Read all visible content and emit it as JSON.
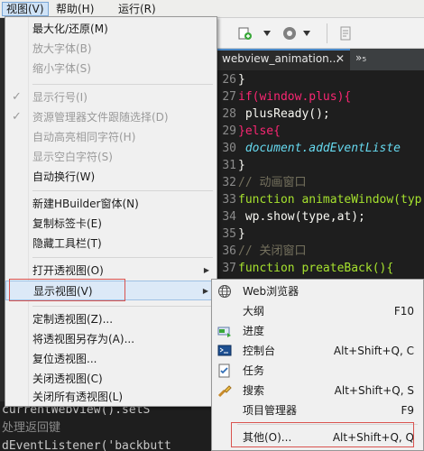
{
  "menubar": {
    "items": [
      {
        "label": "视图(V)"
      },
      {
        "label": "帮助(H)"
      },
      {
        "label": "运行(R)"
      }
    ]
  },
  "editor": {
    "tab_label": "webview_animation...",
    "tab_close": "✕",
    "more_tabs": "»₅",
    "lines": [
      {
        "n": "26",
        "text": "}"
      },
      {
        "n": "27",
        "text": "if(window.plus){"
      },
      {
        "n": "28",
        "text": "    plusReady();"
      },
      {
        "n": "29",
        "text": "}else{"
      },
      {
        "n": "30",
        "text": "    document.addEventListe"
      },
      {
        "n": "31",
        "text": "}"
      },
      {
        "n": "32",
        "text": "// 动画窗口"
      },
      {
        "n": "33",
        "text": "function animateWindow(typ"
      },
      {
        "n": "34",
        "text": "    wp.show(type,at);"
      },
      {
        "n": "35",
        "text": "}"
      },
      {
        "n": "36",
        "text": "// 关闭窗口"
      },
      {
        "n": "37",
        "text": "function preateBack(){"
      }
    ],
    "bottom_lines": [
      "currentWebview().setS",
      "处理返回键",
      "dEventListener('backbutt"
    ]
  },
  "view_menu": {
    "items": [
      {
        "label": "最大化/还原(M)",
        "disabled": false,
        "checked": false
      },
      {
        "label": "放大字体(B)",
        "disabled": true,
        "checked": false
      },
      {
        "label": "缩小字体(S)",
        "disabled": true,
        "checked": false
      },
      {
        "label": "显示行号(I)",
        "disabled": true,
        "checked": true
      },
      {
        "label": "资源管理器文件跟随选择(D)",
        "disabled": true,
        "checked": true
      },
      {
        "label": "自动高亮相同字符(H)",
        "disabled": true,
        "checked": false
      },
      {
        "label": "显示空白字符(S)",
        "disabled": true,
        "checked": false
      },
      {
        "label": "自动换行(W)",
        "disabled": false,
        "checked": false
      },
      {
        "label": "新建HBuilder窗体(N)",
        "disabled": false,
        "checked": false
      },
      {
        "label": "复制标签卡(E)",
        "disabled": false,
        "checked": false
      },
      {
        "label": "隐藏工具栏(T)",
        "disabled": false,
        "checked": false
      },
      {
        "label": "打开透视图(O)",
        "disabled": false,
        "checked": false,
        "submenu": true
      },
      {
        "label": "显示视图(V)",
        "disabled": false,
        "checked": false,
        "submenu": true,
        "highlighted": true
      },
      {
        "label": "定制透视图(Z)...",
        "disabled": false,
        "checked": false
      },
      {
        "label": "将透视图另存为(A)...",
        "disabled": false,
        "checked": false
      },
      {
        "label": "复位透视图...",
        "disabled": false,
        "checked": false
      },
      {
        "label": "关闭透视图(C)",
        "disabled": false,
        "checked": false
      },
      {
        "label": "关闭所有透视图(L)",
        "disabled": false,
        "checked": false
      }
    ],
    "check_glyph": "✓",
    "arrow_glyph": "▶"
  },
  "show_view_submenu": {
    "items": [
      {
        "label": "Web浏览器",
        "shortcut": "",
        "icon": "globe-icon"
      },
      {
        "label": "大纲",
        "shortcut": "F10",
        "icon": ""
      },
      {
        "label": "进度",
        "shortcut": "",
        "icon": "progress-icon"
      },
      {
        "label": "控制台",
        "shortcut": "Alt+Shift+Q, C",
        "icon": "console-icon"
      },
      {
        "label": "任务",
        "shortcut": "",
        "icon": "tasks-icon"
      },
      {
        "label": "搜索",
        "shortcut": "Alt+Shift+Q, S",
        "icon": "search-flashlight-icon"
      },
      {
        "label": "项目管理器",
        "shortcut": "F9",
        "icon": ""
      },
      {
        "label": "其他(O)...",
        "shortcut": "Alt+Shift+Q, Q",
        "icon": "",
        "boxed": true
      }
    ]
  },
  "colors": {
    "highlight": "#dce9f7",
    "annotation_box": "#d9534f",
    "editor_bg": "#1e1e1e"
  }
}
